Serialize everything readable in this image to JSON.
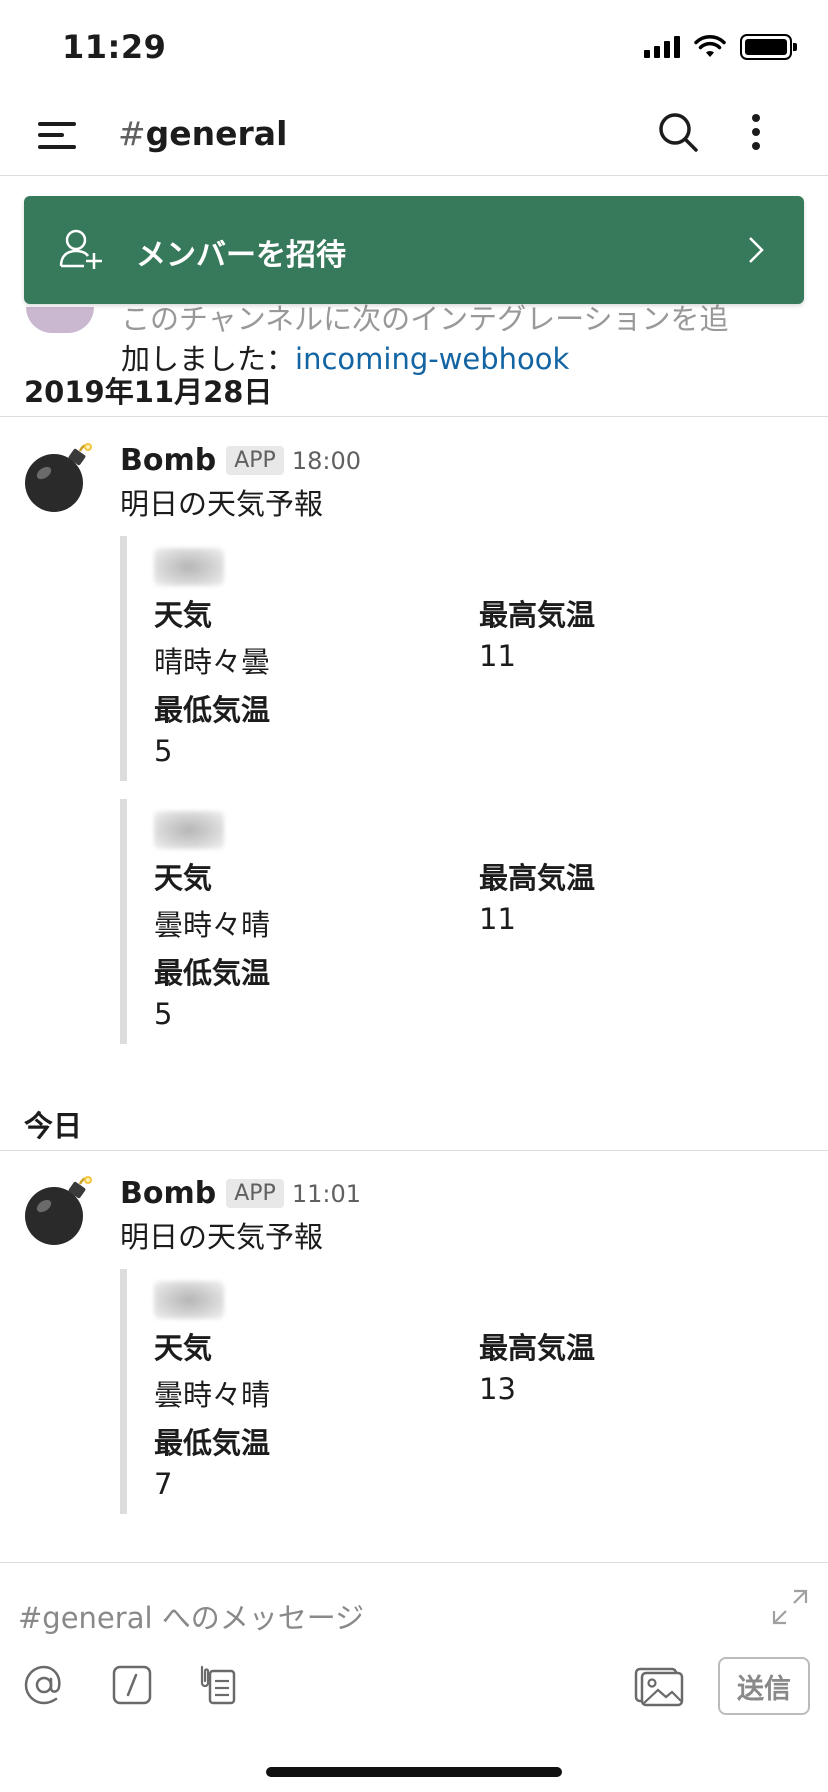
{
  "status_bar": {
    "time": "11:29"
  },
  "header": {
    "hash": "#",
    "channel": "general"
  },
  "invite_banner": {
    "label": "メンバーを招待"
  },
  "partial_message": {
    "line1": "このチャンネルに次のインテグレーションを追",
    "line2_prefix": "加しました：",
    "link": "incoming-webhook"
  },
  "sections": [
    {
      "date": "2019年11月28日",
      "message": {
        "sender": "Bomb",
        "badge": "APP",
        "time": "18:00",
        "text": "明日の天気予報",
        "attachments": [
          {
            "weather_label": "天気",
            "weather": "晴時々曇",
            "high_label": "最高気温",
            "high": "11",
            "low_label": "最低気温",
            "low": "5"
          },
          {
            "weather_label": "天気",
            "weather": "曇時々晴",
            "high_label": "最高気温",
            "high": "11",
            "low_label": "最低気温",
            "low": "5"
          }
        ]
      }
    },
    {
      "date": "今日",
      "message": {
        "sender": "Bomb",
        "badge": "APP",
        "time": "11:01",
        "text": "明日の天気予報",
        "attachments": [
          {
            "weather_label": "天気",
            "weather": "曇時々晴",
            "high_label": "最高気温",
            "high": "13",
            "low_label": "最低気温",
            "low": "7"
          }
        ]
      }
    }
  ],
  "composer": {
    "placeholder": "#general へのメッセージ",
    "send_label": "送信"
  },
  "colors": {
    "banner": "#367a5b",
    "link": "#1264a3"
  },
  "icons": [
    "menu-icon",
    "search-icon",
    "more-icon",
    "add-user-icon",
    "chevron-right-icon",
    "bomb-icon",
    "expand-icon",
    "at-icon",
    "slash-command-icon",
    "shortcut-icon",
    "photo-icon"
  ]
}
